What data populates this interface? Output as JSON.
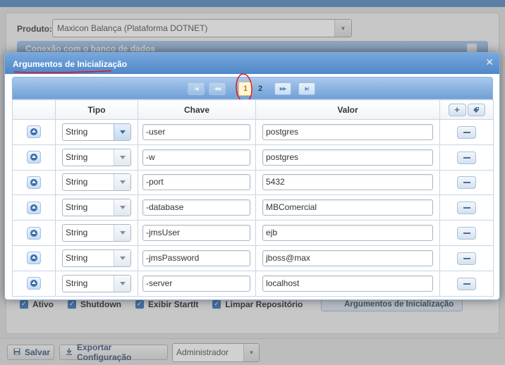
{
  "background": {
    "product_label": "Produto:",
    "product_value": "Maxicon Balança (Plataforma DOTNET)",
    "section_header": "Conexão com o banco de dados",
    "checkboxes": [
      {
        "label": "Ativo",
        "checked": true
      },
      {
        "label": "Shutdown",
        "checked": true
      },
      {
        "label": "Exibir StartIt",
        "checked": true
      },
      {
        "label": "Limpar Repositório",
        "checked": true
      }
    ],
    "args_button": "Argumentos de Inicialização",
    "save_button": "Salvar",
    "export_button": "Exportar Configuração",
    "user_select": "Administrador"
  },
  "dialog": {
    "title": "Argumentos de Inicialização",
    "pager": {
      "pages": [
        "1",
        "2"
      ],
      "current": "1"
    },
    "columns": {
      "tipo": "Tipo",
      "chave": "Chave",
      "valor": "Valor"
    },
    "rows": [
      {
        "tipo": "String",
        "chave": "-user",
        "valor": "postgres"
      },
      {
        "tipo": "String",
        "chave": "-w",
        "valor": "postgres"
      },
      {
        "tipo": "String",
        "chave": "-port",
        "valor": "5432"
      },
      {
        "tipo": "String",
        "chave": "-database",
        "valor": "MBComercial"
      },
      {
        "tipo": "String",
        "chave": "-jmsUser",
        "valor": "ejb"
      },
      {
        "tipo": "String",
        "chave": "-jmsPassword",
        "valor": "jboss@max"
      },
      {
        "tipo": "String",
        "chave": "-server",
        "valor": "localhost"
      }
    ]
  },
  "colors": {
    "header_blue": "#4f87c8",
    "annotation_red": "#e0142a",
    "active_page": "#d07b00"
  }
}
